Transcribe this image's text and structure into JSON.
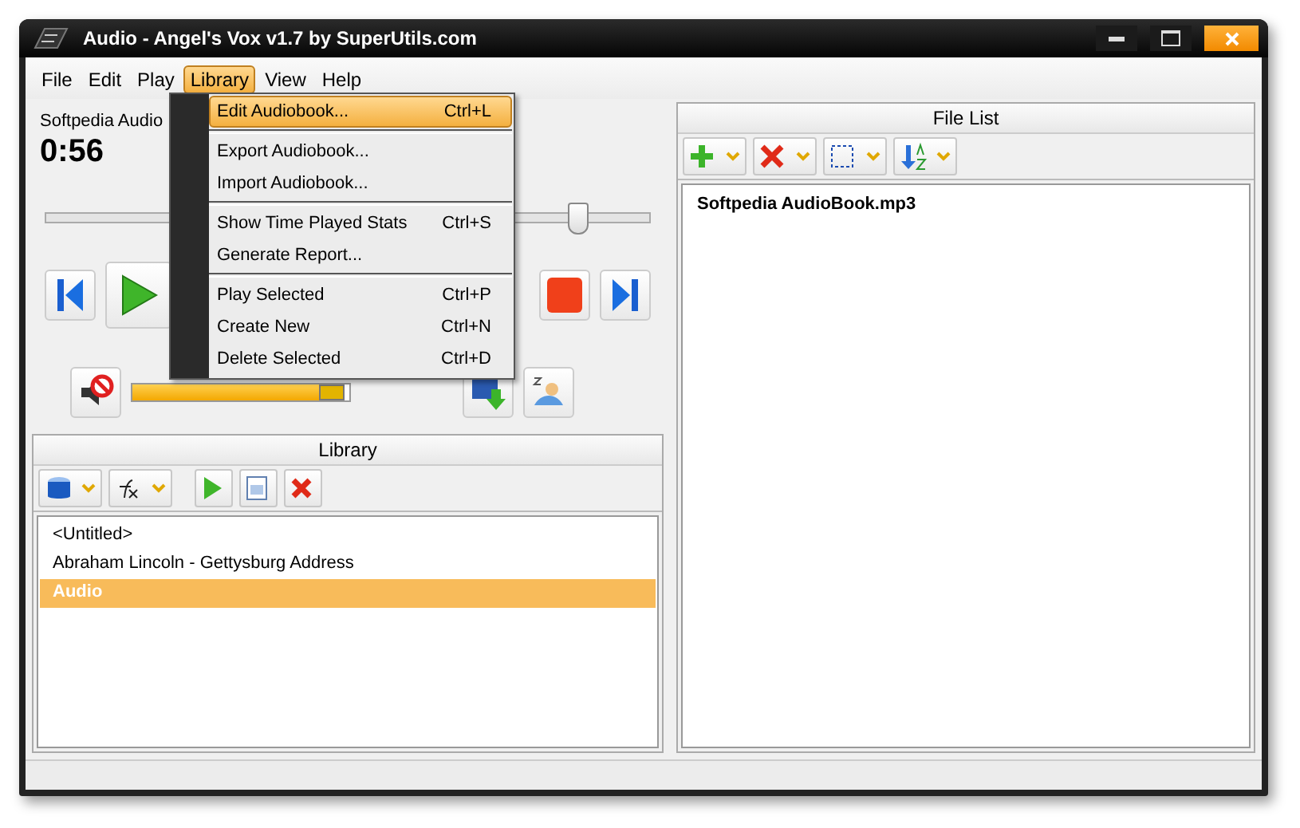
{
  "window": {
    "title": "Audio - Angel's Vox v1.7 by SuperUtils.com"
  },
  "menu_bar": [
    {
      "label": "File",
      "selected": false
    },
    {
      "label": "Edit",
      "selected": false
    },
    {
      "label": "Play",
      "selected": false
    },
    {
      "label": "Library",
      "selected": true
    },
    {
      "label": "View",
      "selected": false
    },
    {
      "label": "Help",
      "selected": false
    }
  ],
  "menu": [
    {
      "kind": "item",
      "label": "Edit Audiobook...",
      "shortcut": "Ctrl+L",
      "selected": true
    },
    {
      "kind": "separator"
    },
    {
      "kind": "item",
      "label": "Export Audiobook...",
      "selected": false
    },
    {
      "kind": "item",
      "label": "Import Audiobook...",
      "selected": false
    },
    {
      "kind": "separator"
    },
    {
      "kind": "item",
      "label": "Show Time Played Stats",
      "shortcut": "Ctrl+S",
      "selected": false
    },
    {
      "kind": "item",
      "label": "Generate Report...",
      "selected": false
    },
    {
      "kind": "separator"
    },
    {
      "kind": "item",
      "label": "Play Selected",
      "shortcut": "Ctrl+P",
      "selected": false
    },
    {
      "kind": "item",
      "label": "Create New",
      "shortcut": "Ctrl+N",
      "selected": false
    },
    {
      "kind": "item",
      "label": "Delete Selected",
      "shortcut": "Ctrl+D",
      "selected": false
    }
  ],
  "player": {
    "track_title": "Softpedia Audio",
    "time": "0:56",
    "seek": {
      "level": 0.88
    },
    "volume": {
      "level": 0.97
    }
  },
  "library": {
    "title": "Library",
    "items": [
      {
        "label": "<Untitled>",
        "selected": false
      },
      {
        "label": "Abraham Lincoln - Gettysburg Address",
        "selected": false
      },
      {
        "label": "Audio",
        "selected": true
      }
    ]
  },
  "file_list": {
    "title": "File List",
    "files": [
      {
        "label": "Softpedia AudioBook.mp3",
        "selected": false
      }
    ]
  }
}
